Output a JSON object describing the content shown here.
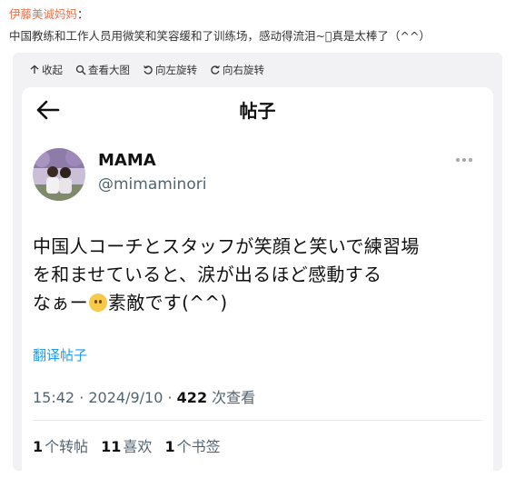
{
  "weibo": {
    "author": "伊藤美诚妈妈",
    "separator": "：",
    "text": "中国教练和工作人员用微笑和笑容缓和了训练场，感动得流泪~􀀀真是太棒了（^^）"
  },
  "toolbar": {
    "collapse_label": "收起",
    "view_large_label": "查看大图",
    "rotate_left_label": "向左旋转",
    "rotate_right_label": "向右旋转"
  },
  "post": {
    "page_title": "帖子",
    "display_name": "MAMA",
    "handle": "@mimaminori",
    "text_line1": "中国人コーチとスタッフが笑顔と笑いで練習場",
    "text_line2": "を和ませていると、涙が出るほど感動する",
    "text_line3_a": "なぁー",
    "text_line3_b": "素敵です(^^)",
    "translate_label": "翻译帖子",
    "timestamp": "15:42 · 2024/9/10 · ",
    "views_count": "422",
    "views_label": " 次查看",
    "reposts_count": "1",
    "reposts_label": "个转帖",
    "likes_count": "11",
    "likes_label": "喜欢",
    "bookmarks_count": "1",
    "bookmarks_label": "个书签"
  },
  "colors": {
    "author": "#eb7350",
    "link": "#1d9bf0",
    "muted": "#536471"
  }
}
